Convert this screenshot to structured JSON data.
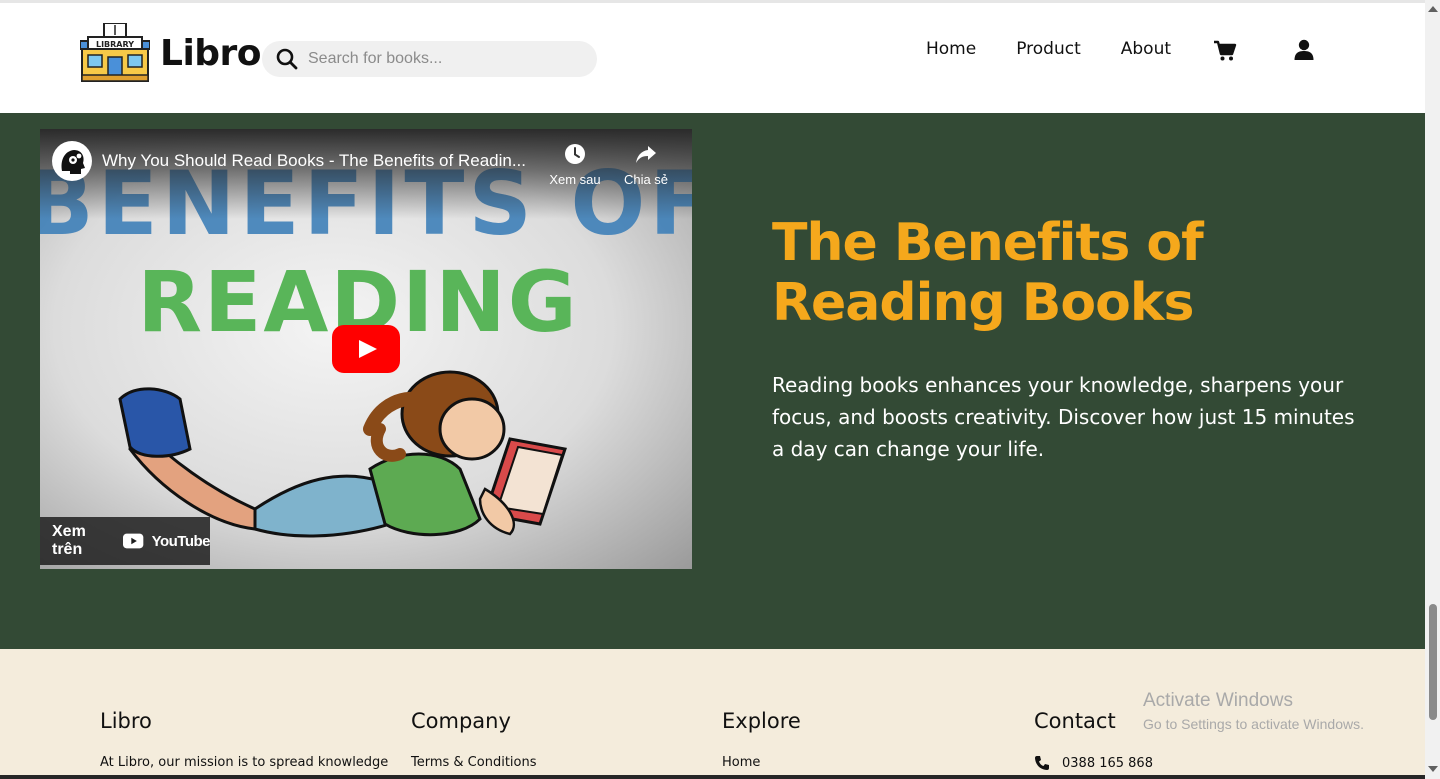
{
  "header": {
    "logo_text": "Libro",
    "logo_sign": "LIBRARY",
    "search_placeholder": "Search for books...",
    "nav": [
      "Home",
      "Product",
      "About"
    ],
    "icons": [
      "cart-icon",
      "user-icon",
      "search-icon"
    ]
  },
  "hero": {
    "video": {
      "title": "Why You Should Read Books - The Benefits of Readin...",
      "art_title_line1": "BENEFITS OF",
      "art_title_line2": "READING",
      "watch_later": "Xem sau",
      "share": "Chia sẻ",
      "watch_on": "Xem trên",
      "youtube": "YouTube"
    },
    "heading": "The Benefits of Reading Books",
    "text": "Reading books enhances your knowledge, sharpens your focus, and boosts creativity. Discover how just 15 minutes a day can change your life.",
    "colors": {
      "background": "#334a35",
      "heading": "#f5a81c"
    }
  },
  "footer": {
    "libro": {
      "title": "Libro",
      "text": "At Libro, our mission is to spread knowledge"
    },
    "company": {
      "title": "Company",
      "link": "Terms & Conditions"
    },
    "explore": {
      "title": "Explore",
      "link": "Home"
    },
    "contact": {
      "title": "Contact",
      "phone": "0388 165 868"
    }
  },
  "os_watermark": {
    "line1": "Activate Windows",
    "line2": "Go to Settings to activate Windows."
  }
}
